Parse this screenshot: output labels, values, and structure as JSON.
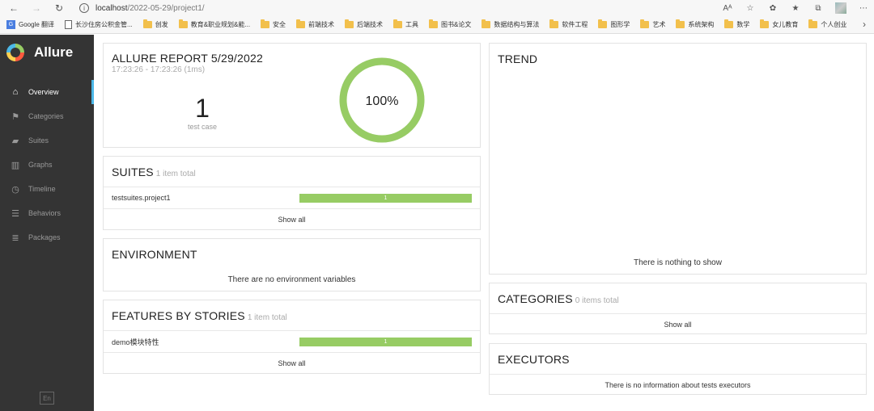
{
  "browser": {
    "url_host": "localhost",
    "url_path": "/2022-05-29/project1/",
    "bookmarks": [
      {
        "label": "Google 翻译",
        "icon": "google-translate-icon"
      },
      {
        "label": "长沙住房公积金管...",
        "icon": "page-icon"
      },
      {
        "label": "创发",
        "icon": "folder-icon"
      },
      {
        "label": "教育&职业规划&能...",
        "icon": "folder-icon"
      },
      {
        "label": "安全",
        "icon": "folder-icon"
      },
      {
        "label": "前端技术",
        "icon": "folder-icon"
      },
      {
        "label": "后端技术",
        "icon": "folder-icon"
      },
      {
        "label": "工具",
        "icon": "folder-icon"
      },
      {
        "label": "图书&论文",
        "icon": "folder-icon"
      },
      {
        "label": "数据结构与算法",
        "icon": "folder-icon"
      },
      {
        "label": "软件工程",
        "icon": "folder-icon"
      },
      {
        "label": "图形学",
        "icon": "folder-icon"
      },
      {
        "label": "艺术",
        "icon": "folder-icon"
      },
      {
        "label": "系统架构",
        "icon": "folder-icon"
      },
      {
        "label": "数学",
        "icon": "folder-icon"
      },
      {
        "label": "女儿教育",
        "icon": "folder-icon"
      },
      {
        "label": "个人创业",
        "icon": "folder-icon"
      }
    ]
  },
  "sidebar": {
    "brand": "Allure",
    "items": [
      {
        "label": "Overview",
        "icon": "home-icon",
        "active": true
      },
      {
        "label": "Categories",
        "icon": "flag-icon",
        "active": false
      },
      {
        "label": "Suites",
        "icon": "briefcase-icon",
        "active": false
      },
      {
        "label": "Graphs",
        "icon": "bar-chart-icon",
        "active": false
      },
      {
        "label": "Timeline",
        "icon": "clock-icon",
        "active": false
      },
      {
        "label": "Behaviors",
        "icon": "list-icon",
        "active": false
      },
      {
        "label": "Packages",
        "icon": "packages-icon",
        "active": false
      }
    ],
    "language": "En"
  },
  "summary": {
    "title": "ALLURE REPORT 5/29/2022",
    "time_range": "17:23:26 - 17:23:26 (1ms)",
    "test_count": "1",
    "test_count_label": "test case",
    "pass_rate_label": "100%",
    "pass_fraction": 1.0
  },
  "suites": {
    "title": "SUITES",
    "subtitle": "1 item total",
    "rows": [
      {
        "name": "testsuites.project1",
        "count": "1"
      }
    ],
    "show_all": "Show all"
  },
  "environment": {
    "title": "ENVIRONMENT",
    "message": "There are no environment variables"
  },
  "features": {
    "title": "FEATURES BY STORIES",
    "subtitle": "1 item total",
    "rows": [
      {
        "name": "demo模块特性",
        "count": "1"
      }
    ],
    "show_all": "Show all"
  },
  "trend": {
    "title": "TREND",
    "message": "There is nothing to show"
  },
  "categories": {
    "title": "CATEGORIES",
    "subtitle": "0 items total",
    "show_all": "Show all"
  },
  "executors": {
    "title": "EXECUTORS",
    "message": "There is no information about tests executors"
  },
  "colors": {
    "passed": "#97cc64",
    "sidebar_bg": "#343434",
    "active_indicator": "#4cb8e8"
  }
}
